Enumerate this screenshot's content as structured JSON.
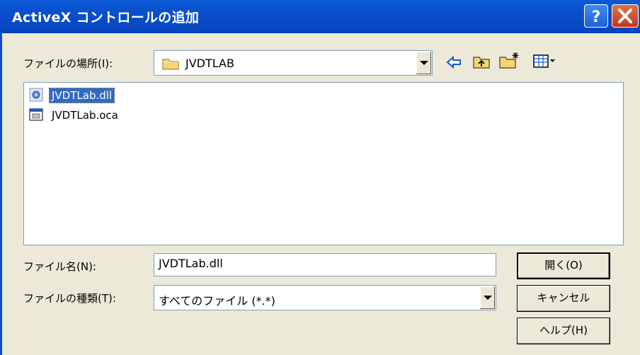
{
  "window": {
    "title": "ActiveX コントロールの追加",
    "help_glyph": "?",
    "close_glyph": "×"
  },
  "location": {
    "label": "ファイルの場所(I):",
    "value": "JVDTLAB"
  },
  "toolbar": {
    "icons": [
      "back-arrow-icon",
      "up-folder-icon",
      "new-folder-icon",
      "view-menu-icon"
    ]
  },
  "files": [
    {
      "name": "JVDTLab.dll",
      "icon": "dll-file-icon",
      "selected": true
    },
    {
      "name": "JVDTLab.oca",
      "icon": "oca-file-icon",
      "selected": false
    }
  ],
  "filename": {
    "label": "ファイル名(N):",
    "value": "JVDTLab.dll"
  },
  "filetype": {
    "label": "ファイルの種類(T):",
    "value": "すべてのファイル (*.*)"
  },
  "buttons": {
    "open": "開く(O)",
    "cancel": "キャンセル",
    "help": "ヘルプ(H)"
  },
  "colors": {
    "titlebar": "#0a4fcc",
    "selection": "#316ac5",
    "dialog_bg": "#ece9d8"
  }
}
